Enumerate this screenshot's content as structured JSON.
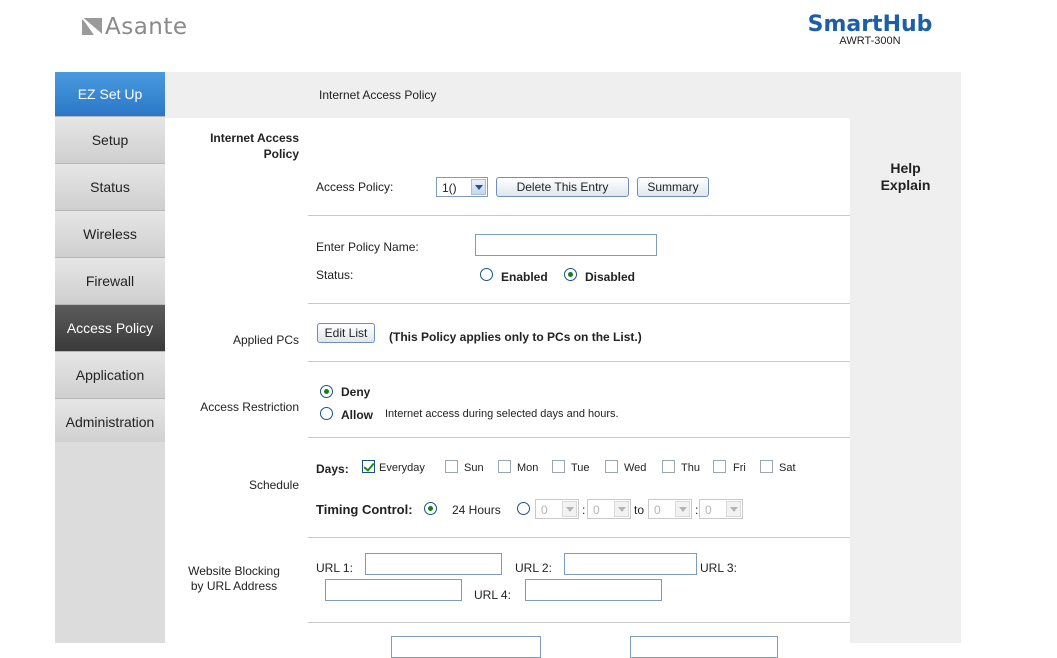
{
  "header": {
    "brand": "Asante",
    "product_name": "SmartHub",
    "model": "AWRT-300N"
  },
  "sidebar": {
    "items": [
      {
        "label": "EZ Set Up"
      },
      {
        "label": "Setup"
      },
      {
        "label": "Status"
      },
      {
        "label": "Wireless"
      },
      {
        "label": "Firewall"
      },
      {
        "label": "Access Policy"
      },
      {
        "label": "Application"
      },
      {
        "label": "Administration"
      }
    ]
  },
  "page_title": "Internet Access Policy",
  "help": {
    "line1": "Help",
    "line2": "Explain"
  },
  "section": {
    "internet_access_policy_line1": "Internet Access",
    "internet_access_policy_line2": "Policy"
  },
  "policy": {
    "label": "Access Policy:",
    "selected": "1()",
    "delete_label": "Delete This Entry",
    "summary_label": "Summary"
  },
  "name": {
    "label": "Enter Policy Name:",
    "value": ""
  },
  "status": {
    "label": "Status:",
    "enabled_label": "Enabled",
    "disabled_label": "Disabled",
    "selected": "Disabled"
  },
  "applied": {
    "label": "Applied PCs",
    "edit_label": "Edit List",
    "note": "(This Policy applies only to PCs on the List.)"
  },
  "restriction": {
    "label": "Access Restriction",
    "deny_label": "Deny",
    "allow_label": "Allow",
    "allow_note": "Internet access during selected days and hours.",
    "selected": "Deny"
  },
  "schedule": {
    "label": "Schedule",
    "days_label": "Days:",
    "days": [
      {
        "label": "Everyday",
        "checked": true
      },
      {
        "label": "Sun",
        "checked": false
      },
      {
        "label": "Mon",
        "checked": false
      },
      {
        "label": "Tue",
        "checked": false
      },
      {
        "label": "Wed",
        "checked": false
      },
      {
        "label": "Thu",
        "checked": false
      },
      {
        "label": "Fri",
        "checked": false
      },
      {
        "label": "Sat",
        "checked": false
      }
    ],
    "timing_label": "Timing Control:",
    "hours24_label": "24 Hours",
    "to_label": "to",
    "colon": ":",
    "time_values": [
      "0",
      "0",
      "0",
      "0"
    ]
  },
  "url_block": {
    "label_line1": "Website Blocking",
    "label_line2": "by URL Address",
    "url1_label": "URL 1:",
    "url2_label": "URL 2:",
    "url3_label": "URL 3:",
    "url4_label": "URL 4:"
  },
  "colors": {
    "accent_blue": "#2a78c7",
    "active_nav": "#3a3a3a",
    "brand_gray": "#8a8a8a",
    "product_blue": "#1c5fa8"
  }
}
